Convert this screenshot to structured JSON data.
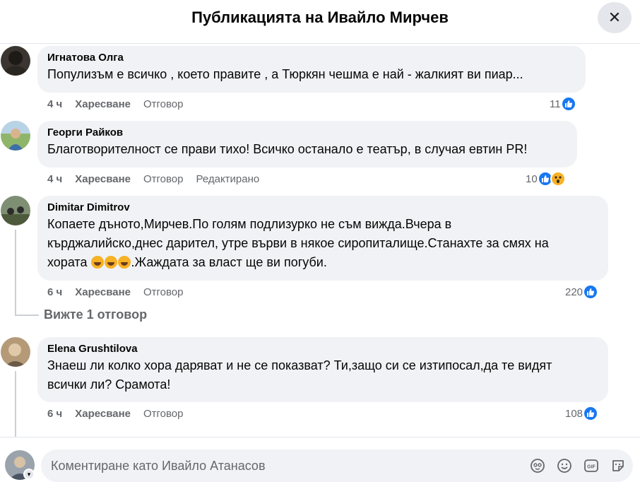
{
  "header": {
    "title": "Публикацията на Ивайло Мирчев",
    "close_glyph": "✕"
  },
  "comments": [
    {
      "author": "Игнатова Олга",
      "lines": [
        "Популизъм е всичко , което правите , а Тюркян чешма е най - жалкият ви пиар..."
      ],
      "time": "4 ч",
      "like": "Харесване",
      "reply": "Отговор",
      "edited": "",
      "reaction_count": "11",
      "reactions": [
        "like-icon"
      ]
    },
    {
      "author": "Георги Райков",
      "lines": [
        "Благотворителност се прави тихо! Всичко останало е театър, в случая евтин PR!"
      ],
      "time": "4 ч",
      "like": "Харесване",
      "reply": "Отговор",
      "edited": "Редактирано",
      "reaction_count": "10",
      "reactions": [
        "like-icon",
        "wow-icon"
      ]
    },
    {
      "author": "Dimitar Dimitrov",
      "lines": [
        "Копаете дъното,Мирчев.По голям подлизурко не съм вижда.Вчера в",
        "кърджалийско,днес дарител, утре върви в някое сиропиталище.Станахте за смях на",
        ".Жаждата за власт ще ви погуби."
      ],
      "line3_prefix": "хората ",
      "time": "6 ч",
      "like": "Харесване",
      "reply": "Отговор",
      "edited": "",
      "reaction_count": "220",
      "reactions": [
        "like-icon"
      ],
      "replies_link": "Вижте 1 отговор"
    },
    {
      "author": "Elena Grushtilova",
      "lines": [
        "Знаеш ли колко хора даряват и не се показват? Ти,защо си се изтипосал,да те видят",
        "всички ли? Срамота!"
      ],
      "time": "6 ч",
      "like": "Харесване",
      "reply": "Отговор",
      "edited": "",
      "reaction_count": "108",
      "reactions": [
        "like-icon"
      ]
    }
  ],
  "composer": {
    "placeholder": "Коментиране като Ивайло Атанасов",
    "icons": [
      "avatar-sticker-icon",
      "emoji-icon",
      "gif-icon",
      "sticker-icon"
    ]
  },
  "colors": {
    "accent": "#1877f2",
    "bubble": "#f0f2f5",
    "muted": "#65676b",
    "wow": "#f7b125"
  }
}
